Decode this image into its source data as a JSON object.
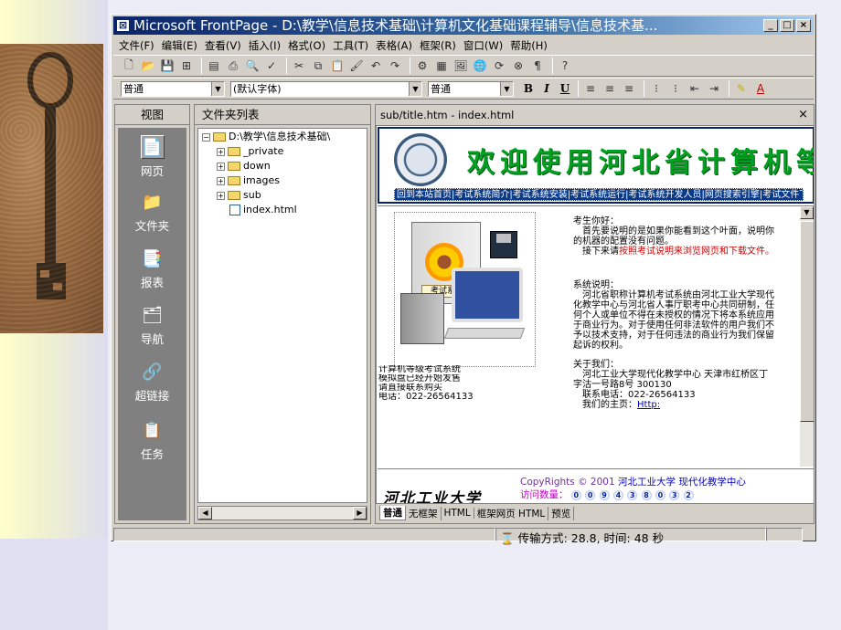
{
  "window": {
    "title": "Microsoft FrontPage - D:\\教学\\信息技术基础\\计算机文化基础课程辅导\\信息技术基..."
  },
  "menu": [
    "文件(F)",
    "编辑(E)",
    "查看(V)",
    "插入(I)",
    "格式(O)",
    "工具(T)",
    "表格(A)",
    "框架(R)",
    "窗口(W)",
    "帮助(H)"
  ],
  "format_toolbar": {
    "style_value": "普通",
    "font_value": "(默认字体)",
    "size_value": "普通"
  },
  "views": {
    "header": "视图",
    "items": [
      {
        "label": "网页",
        "icon": "page-view-icon",
        "active": true
      },
      {
        "label": "文件夹",
        "icon": "folders-view-icon"
      },
      {
        "label": "报表",
        "icon": "reports-view-icon"
      },
      {
        "label": "导航",
        "icon": "navigation-view-icon"
      },
      {
        "label": "超链接",
        "icon": "hyperlinks-view-icon"
      },
      {
        "label": "任务",
        "icon": "tasks-view-icon"
      }
    ]
  },
  "folders": {
    "header": "文件夹列表",
    "root": "D:\\教学\\信息技术基础\\",
    "items": [
      "_private",
      "down",
      "images",
      "sub",
      "index.html"
    ]
  },
  "editor": {
    "tab_title": "sub/title.htm - index.html",
    "banner_title": "欢迎使用河北省计算机等",
    "nav_links": "回到本站首页|考试系统简介|考试系统安装|考试系统运行|考试系统开发人员|网页搜索引擎|考试文件下载",
    "product_lines": [
      "计算机等级考试系统",
      "模拟盘已经开始发售",
      "请直接联系购买",
      "电话：022-26564133"
    ],
    "box_label": "考试系统",
    "info": {
      "greeting": "考生你好：",
      "p1": "首先要说明的是如果你能看到这个叶面，说明你的机器的配置没有问题。",
      "p2_prefix": "接下来请",
      "p2_link": "按照考试说明来浏览网页和下载文件。",
      "sys_title": "系统说明：",
      "sys_body": "河北省职称计算机考试系统由河北工业大学现代化教学中心与河北省人事厅职考中心共同研制，任何个人或单位不得在未授权的情况下将本系统应用于商业行为。对于使用任何非法软件的用户我们不予以技术支持，对于任何违法的商业行为我们保留起诉的权利。",
      "about_title": "关于我们：",
      "about_body": "河北工业大学现代化教学中心 天津市红桥区丁字沽一号路8号 300130",
      "phone": "联系电话：022-26564133",
      "homepage_label": "我们的主页：",
      "homepage_link": "Http:"
    },
    "footer": {
      "signature": "河北工业大学",
      "copyright": "CopyRights © 2001",
      "copyright_org": "河北工业大学 现代化教学中心",
      "visits_label": "访问数量：",
      "visit_digits": [
        "0",
        "0",
        "9",
        "4",
        "3",
        "8",
        "0",
        "3",
        "2"
      ]
    },
    "tabs": [
      "普通",
      "无框架",
      "HTML",
      "框架网页 HTML",
      "预览"
    ]
  },
  "status": {
    "transfer": "传输方式: 28.8, 时间: 48 秒"
  }
}
